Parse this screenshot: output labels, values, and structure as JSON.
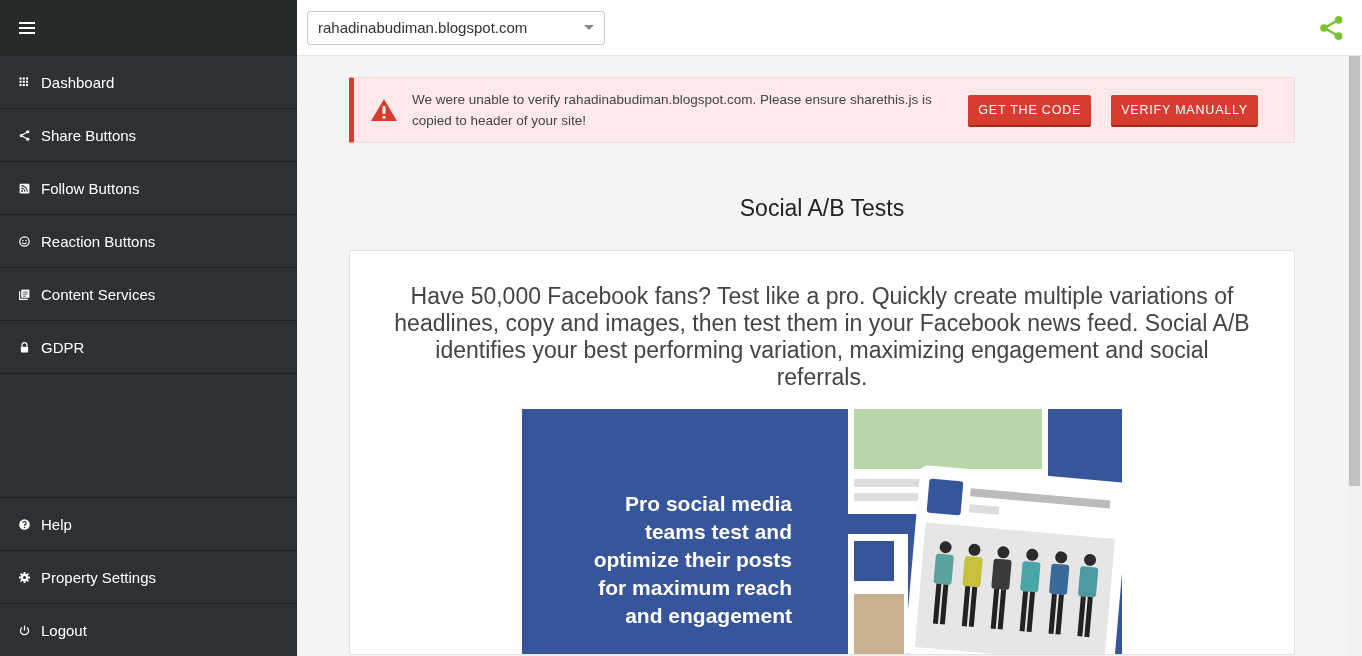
{
  "sidebar": {
    "nav_items": [
      {
        "label": "Dashboard"
      },
      {
        "label": "Share Buttons"
      },
      {
        "label": "Follow Buttons"
      },
      {
        "label": "Reaction Buttons"
      },
      {
        "label": "Content Services"
      },
      {
        "label": "GDPR"
      }
    ],
    "bottom_items": [
      {
        "label": "Help"
      },
      {
        "label": "Property Settings"
      },
      {
        "label": "Logout"
      }
    ]
  },
  "topbar": {
    "property_select": {
      "value": "rahadinabudiman.blogspot.com"
    }
  },
  "alert": {
    "message": "We were unable to verify rahadinabudiman.blogspot.com. Please ensure sharethis.js is copied to header of your site!",
    "buttons": [
      "GET THE CODE",
      "VERIFY MANUALLY"
    ]
  },
  "page": {
    "title": "Social A/B Tests",
    "description": "Have 50,000 Facebook fans? Test like a pro. Quickly create multiple variations of headlines, copy and images, then test them in your Facebook news feed. Social A/B identifies your best performing variation, maximizing engagement and social referrals.",
    "promo_text": "Pro social media teams test and optimize their posts for maximum reach and engagement"
  }
}
